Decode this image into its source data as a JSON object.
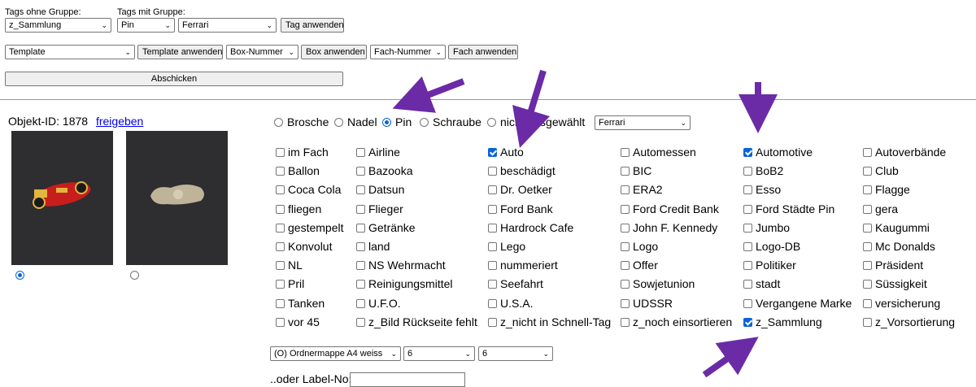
{
  "top": {
    "tags_ohne_label": "Tags ohne Gruppe:",
    "tags_mit_label": "Tags mit Gruppe:",
    "sel_ohne": "z_Sammlung",
    "sel_gruppe": "Pin",
    "sel_wert": "Ferrari",
    "tag_anwenden": "Tag anwenden",
    "template_sel": "Template",
    "template_btn": "Template anwenden",
    "box_sel": "Box-Nummer",
    "box_btn": "Box anwenden",
    "fach_sel": "Fach-Nummer",
    "fach_btn": "Fach anwenden",
    "abschicken": "Abschicken"
  },
  "object": {
    "id_label": "Objekt-ID: 1878",
    "freigeben": "freigeben"
  },
  "types": [
    {
      "label": "Brosche",
      "selected": false
    },
    {
      "label": "Nadel",
      "selected": false
    },
    {
      "label": "Pin",
      "selected": true
    },
    {
      "label": "Schraube",
      "selected": false
    },
    {
      "label": "nicht ausgewählt",
      "selected": false
    }
  ],
  "type_select": "Ferrari",
  "tags": [
    [
      "im Fach",
      "Airline",
      "Auto",
      "Automessen",
      "Automotive",
      "Autoverbände"
    ],
    [
      "Ballon",
      "Bazooka",
      "beschädigt",
      "BIC",
      "BoB2",
      "Club"
    ],
    [
      "Coca Cola",
      "Datsun",
      "Dr. Oetker",
      "ERA2",
      "Esso",
      "Flagge"
    ],
    [
      "fliegen",
      "Flieger",
      "Ford Bank",
      "Ford Credit Bank",
      "Ford Städte Pin",
      "gera"
    ],
    [
      "gestempelt",
      "Getränke",
      "Hardrock Cafe",
      "John F. Kennedy",
      "Jumbo",
      "Kaugummi"
    ],
    [
      "Konvolut",
      "land",
      "Lego",
      "Logo",
      "Logo-DB",
      "Mc Donalds"
    ],
    [
      "NL",
      "NS Wehrmacht",
      "nummeriert",
      "Offer",
      "Politiker",
      "Präsident"
    ],
    [
      "Pril",
      "Reinigungsmittel",
      "Seefahrt",
      "Sowjetunion",
      "stadt",
      "Süssigkeit"
    ],
    [
      "Tanken",
      "U.F.O.",
      "U.S.A.",
      "UDSSR",
      "Vergangene Marke",
      "versicherung"
    ],
    [
      "vor 45",
      "z_Bild Rückseite fehlt",
      "z_nicht in Schnell-Tag",
      "z_noch einsortieren",
      "z_Sammlung",
      "z_Vorsortierung"
    ]
  ],
  "checked": [
    "Auto",
    "Automotive",
    "z_Sammlung"
  ],
  "bottom": {
    "ordner": "(O) Ordnermappe A4 weiss",
    "n1": "6",
    "n2": "6",
    "label_no": "..oder Label-No:"
  },
  "colors": {
    "arrow": "#6b2aa6",
    "accent": "#0a64d8"
  }
}
